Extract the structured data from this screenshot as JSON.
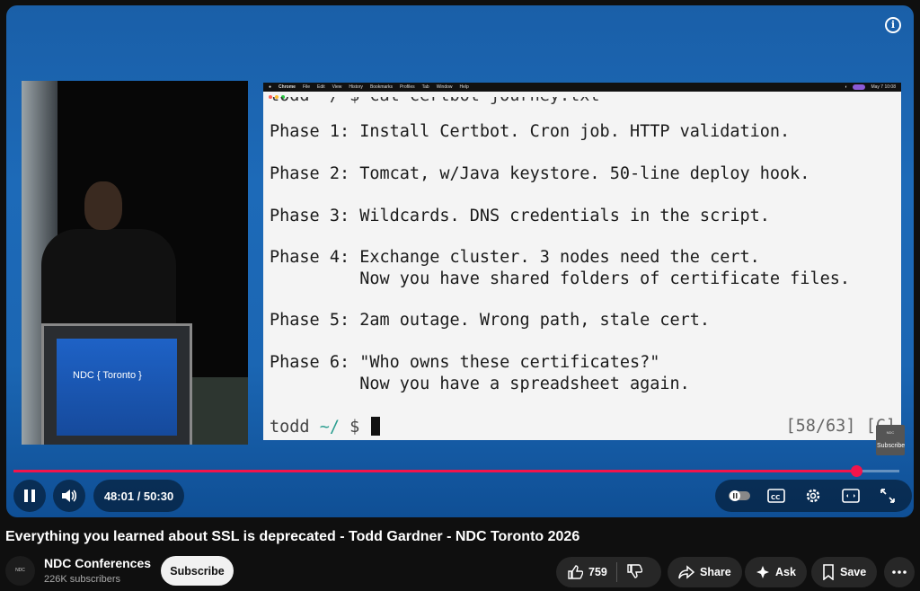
{
  "slide": {
    "menubar": {
      "app": "Chrome",
      "items": [
        "File",
        "Edit",
        "View",
        "History",
        "Bookmarks",
        "Profiles",
        "Tab",
        "Window",
        "Help"
      ],
      "clock": "May 7  10:08"
    },
    "top_cut_line": "todd ~/ $ cat certbot-journey.txt",
    "lines": [
      "Phase 1: Install Certbot. Cron job. HTTP validation.",
      "Phase 2: Tomcat, w/Java keystore. 50-line deploy hook.",
      "Phase 3: Wildcards. DNS credentials in the script.",
      "Phase 4: Exchange cluster. 3 nodes need the cert.",
      "         Now you have shared folders of certificate files.",
      "Phase 5: 2am outage. Wrong path, stale cert.",
      "Phase 6: \"Who owns these certificates?\"",
      "         Now you have a spreadsheet again."
    ],
    "prompt_user": "todd",
    "prompt_tilde": "~/",
    "prompt_symbol": "$",
    "counter": "[58/63] [C]"
  },
  "camera": {
    "podium_logo": "NDC { Toronto }"
  },
  "player": {
    "subscribe_watermark": "Subscribe",
    "time_current": "48:01",
    "time_sep": " / ",
    "time_total": "50:30",
    "progress_fraction": 0.951
  },
  "video": {
    "title": "Everything you learned about SSL is deprecated - Todd Gardner - NDC Toronto 2026"
  },
  "channel": {
    "name": "NDC Conferences",
    "subscribers": "226K subscribers",
    "avatar_text": "NDC Conferences",
    "subscribe_label": "Subscribe"
  },
  "actions": {
    "likes": "759",
    "share": "Share",
    "ask": "Ask",
    "save": "Save"
  },
  "icons": [
    "info-icon",
    "pause-icon",
    "volume-icon",
    "autoplay-toggle-icon",
    "captions-icon",
    "settings-icon",
    "miniplayer-icon",
    "fullscreen-icon",
    "like-icon",
    "dislike-icon",
    "share-icon",
    "sparkle-icon",
    "save-icon",
    "more-icon"
  ],
  "colors": {
    "accent": "#f2144c",
    "player_bg": "#1b66b3",
    "page_bg": "#0f0f0f"
  }
}
